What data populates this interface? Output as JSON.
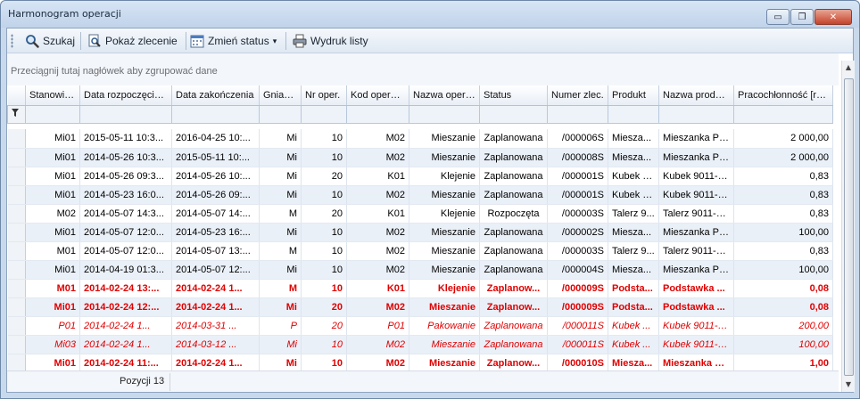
{
  "window": {
    "title": "Harmonogram operacji",
    "minimize": "▭",
    "restore": "❐",
    "close": "✕"
  },
  "toolbar": {
    "search_label": "Szukaj",
    "show_order_label": "Pokaż zlecenie",
    "change_status_label": "Zmień status",
    "change_status_arrow": "▾",
    "print_label": "Wydruk listy"
  },
  "group_panel": {
    "text": "Przeciągnij tutaj nagłówek aby zgrupować dane"
  },
  "grid": {
    "columns": [
      "Stanowisko",
      "Data rozpoczęcia",
      "Data zakończenia",
      "Gniazdo",
      "Nr oper.",
      "Kod operacji",
      "Nazwa operacji",
      "Status",
      "Numer zlec.",
      "Produkt",
      "Nazwa produktu",
      "Pracochłonność [rbg]"
    ],
    "sort_indicator": "▼",
    "filter_icon": "funnel-icon",
    "rows": [
      {
        "style": "normal",
        "cells": [
          "Mi01",
          "2015-05-11 10:3...",
          "2016-04-25 10:...",
          "Mi",
          "10",
          "M02",
          "Mieszanie",
          "Zaplanowana",
          "/000006S",
          "Miesza...",
          "Mieszanka PC...",
          "2 000,00"
        ]
      },
      {
        "style": "normal",
        "cells": [
          "Mi01",
          "2014-05-26 10:3...",
          "2015-05-11 10:...",
          "Mi",
          "10",
          "M02",
          "Mieszanie",
          "Zaplanowana",
          "/000008S",
          "Miesza...",
          "Mieszanka PC...",
          "2 000,00"
        ]
      },
      {
        "style": "normal",
        "cells": [
          "Mi01",
          "2014-05-26 09:3...",
          "2014-05-26 10:...",
          "Mi",
          "20",
          "K01",
          "Klejenie",
          "Zaplanowana",
          "/000001S",
          "Kubek 9...",
          "Kubek 9011-180",
          "0,83"
        ]
      },
      {
        "style": "normal",
        "cells": [
          "Mi01",
          "2014-05-23 16:0...",
          "2014-05-26 09:...",
          "Mi",
          "10",
          "M02",
          "Mieszanie",
          "Zaplanowana",
          "/000001S",
          "Kubek 9...",
          "Kubek 9011-180",
          "0,83"
        ]
      },
      {
        "style": "normal",
        "cells": [
          "M02",
          "2014-05-07 14:3...",
          "2014-05-07 14:...",
          "M",
          "20",
          "K01",
          "Klejenie",
          "Rozpoczęta",
          "/000003S",
          "Talerz 9...",
          "Talerz 9011-180",
          "0,83"
        ]
      },
      {
        "style": "normal",
        "cells": [
          "Mi01",
          "2014-05-07 12:0...",
          "2014-05-23 16:...",
          "Mi",
          "10",
          "M02",
          "Mieszanie",
          "Zaplanowana",
          "/000002S",
          "Miesza...",
          "Mieszanka PC...",
          "100,00"
        ]
      },
      {
        "style": "normal",
        "cells": [
          "M01",
          "2014-05-07 12:0...",
          "2014-05-07 13:...",
          "M",
          "10",
          "M02",
          "Mieszanie",
          "Zaplanowana",
          "/000003S",
          "Talerz 9...",
          "Talerz 9011-180",
          "0,83"
        ]
      },
      {
        "style": "normal",
        "cells": [
          "Mi01",
          "2014-04-19 01:3...",
          "2014-05-07 12:...",
          "Mi",
          "10",
          "M02",
          "Mieszanie",
          "Zaplanowana",
          "/000004S",
          "Miesza...",
          "Mieszanka PC...",
          "100,00"
        ]
      },
      {
        "style": "red",
        "cells": [
          "M01",
          "2014-02-24 13:...",
          "2014-02-24 1...",
          "M",
          "10",
          "K01",
          "Klejenie",
          "Zaplanow...",
          "/000009S",
          "Podsta...",
          "Podstawka ...",
          "0,08"
        ]
      },
      {
        "style": "red",
        "cells": [
          "Mi01",
          "2014-02-24 12:...",
          "2014-02-24 1...",
          "Mi",
          "20",
          "M02",
          "Mieszanie",
          "Zaplanow...",
          "/000009S",
          "Podsta...",
          "Podstawka ...",
          "0,08"
        ]
      },
      {
        "style": "redi",
        "cells": [
          "P01",
          "2014-02-24 1...",
          "2014-03-31 ...",
          "P",
          "20",
          "P01",
          "Pakowanie",
          "Zaplanowana",
          "/000011S",
          "Kubek ...",
          "Kubek 9011-180",
          "200,00"
        ]
      },
      {
        "style": "redi",
        "cells": [
          "Mi03",
          "2014-02-24 1...",
          "2014-03-12 ...",
          "Mi",
          "10",
          "M02",
          "Mieszanie",
          "Zaplanowana",
          "/000011S",
          "Kubek ...",
          "Kubek 9011-180",
          "100,00"
        ]
      },
      {
        "style": "red",
        "cells": [
          "Mi01",
          "2014-02-24 11:...",
          "2014-02-24 1...",
          "Mi",
          "10",
          "M02",
          "Mieszanie",
          "Zaplanow...",
          "/000010S",
          "Miesza...",
          "Mieszanka PC...",
          "1,00"
        ]
      }
    ]
  },
  "footer": {
    "count_label": "Pozycji 13"
  },
  "colors": {
    "highlight_red": "#e00000",
    "row_alt": "#eaf0f8",
    "frame": "#c9d9ec"
  }
}
